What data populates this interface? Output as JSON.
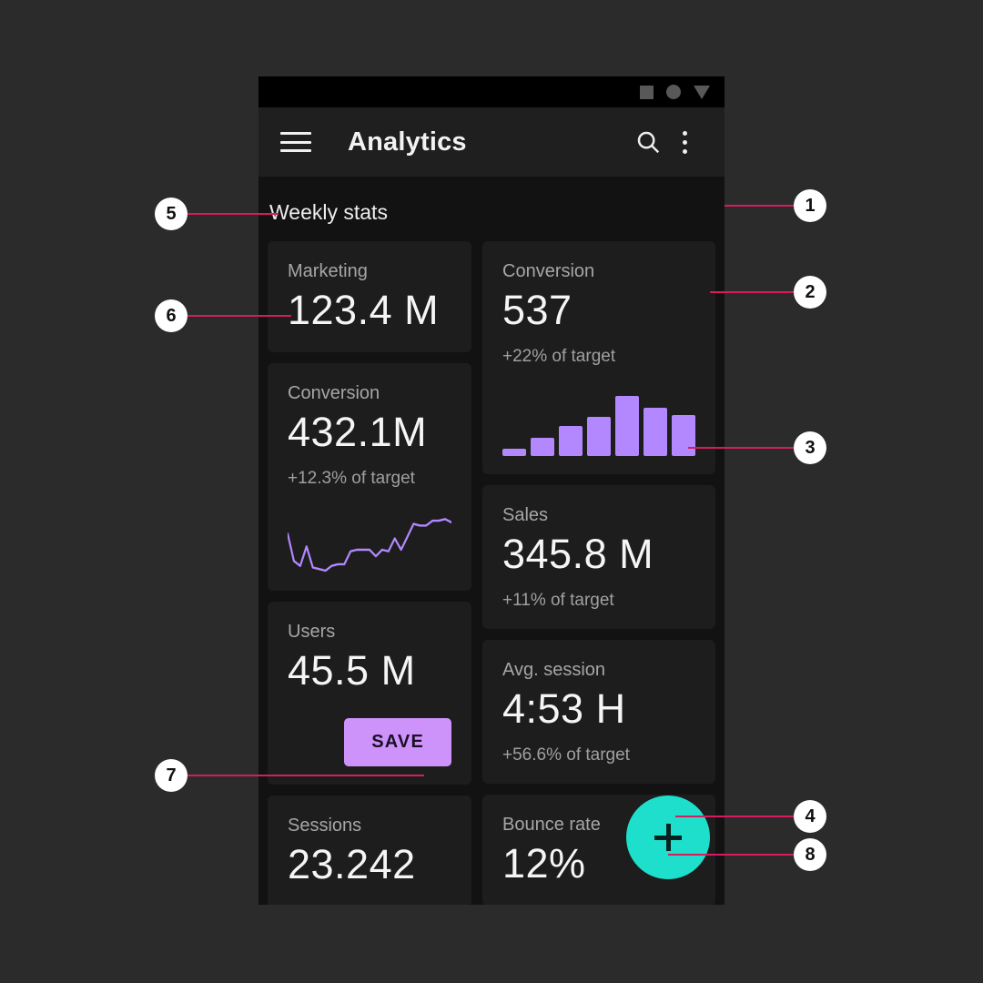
{
  "app": {
    "title": "Analytics",
    "status_bar_icons": [
      "square-icon",
      "circle-icon",
      "triangle-down-icon"
    ],
    "menu_icon": "hamburger-menu-icon",
    "search_icon": "search-icon",
    "overflow_icon": "more-vertical-icon",
    "fab_icon": "plus-icon",
    "accent_purple": "#b388ff",
    "accent_teal": "#1edfcb",
    "save_button_color": "#ce93fb",
    "callout_color": "#d81b60",
    "background": "#121212",
    "card_background": "#1d1d1d"
  },
  "section": {
    "title": "Weekly stats"
  },
  "cards": {
    "marketing": {
      "label": "Marketing",
      "value": "123.4 M"
    },
    "conversion_left": {
      "label": "Conversion",
      "value": "432.1M",
      "sub": "+12.3% of target"
    },
    "users": {
      "label": "Users",
      "value": "45.5 M",
      "button": "SAVE"
    },
    "sessions": {
      "label": "Sessions",
      "value": "23.242"
    },
    "conversion_right": {
      "label": "Conversion",
      "value": "537",
      "sub": "+22% of target"
    },
    "sales": {
      "label": "Sales",
      "value": "345.8 M",
      "sub": "+11% of target"
    },
    "avg_session": {
      "label": "Avg. session",
      "value": "4:53 H",
      "sub": "+56.6% of target"
    },
    "bounce_rate": {
      "label": "Bounce rate",
      "value": "12%"
    }
  },
  "chart_data": [
    {
      "type": "bar",
      "title": "Conversion weekly bars",
      "categories": [
        "1",
        "2",
        "3",
        "4",
        "5",
        "6",
        "7"
      ],
      "values": [
        8,
        20,
        32,
        42,
        64,
        52,
        44
      ],
      "color": "#b388ff",
      "ylim": [
        0,
        70
      ],
      "xlabel": "",
      "ylabel": "",
      "grid": false,
      "legend": "none"
    },
    {
      "type": "line",
      "title": "Conversion sparkline",
      "color": "#b388ff",
      "x": [
        0,
        1,
        2,
        3,
        4,
        5,
        6,
        7,
        8,
        9,
        10,
        11,
        12,
        13,
        14,
        15,
        16,
        17,
        18,
        19,
        20,
        21,
        22,
        23,
        24,
        25,
        26
      ],
      "y": [
        46,
        12,
        6,
        30,
        4,
        2,
        0,
        6,
        8,
        8,
        24,
        26,
        26,
        26,
        18,
        26,
        24,
        40,
        26,
        42,
        58,
        56,
        56,
        62,
        62,
        64,
        60
      ],
      "ylim": [
        0,
        70
      ],
      "grid": false,
      "legend": "none"
    }
  ],
  "callouts": [
    {
      "id": "1",
      "number": "1"
    },
    {
      "id": "2",
      "number": "2"
    },
    {
      "id": "3",
      "number": "3"
    },
    {
      "id": "4",
      "number": "4"
    },
    {
      "id": "5",
      "number": "5"
    },
    {
      "id": "6",
      "number": "6"
    },
    {
      "id": "7",
      "number": "7"
    },
    {
      "id": "8",
      "number": "8"
    }
  ]
}
